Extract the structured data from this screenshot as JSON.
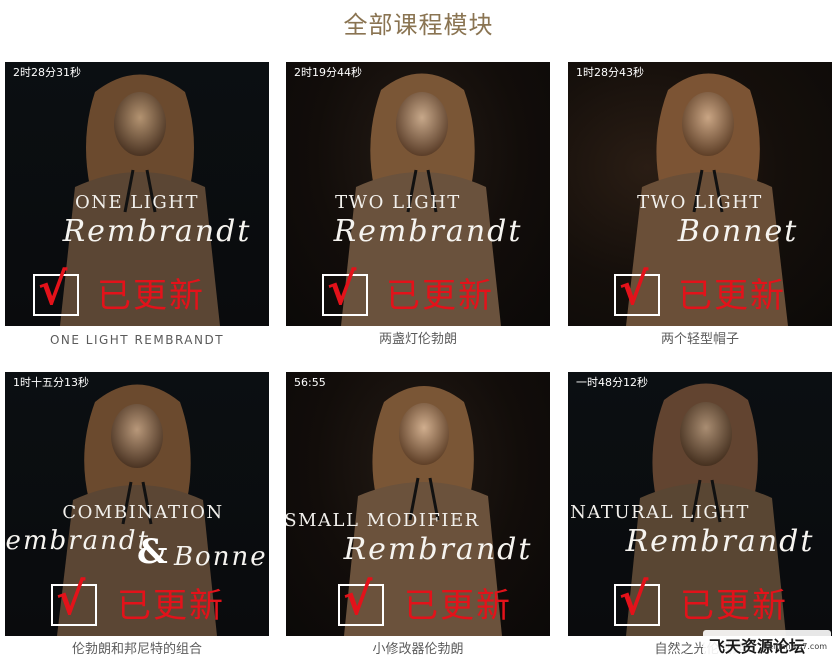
{
  "page_title": "全部课程模块",
  "updated_label": "已更新",
  "check_glyph": "√",
  "courses": [
    {
      "duration": "2时28分31秒",
      "thumb_top": "ONE LIGHT",
      "thumb_script": "Rembrandt",
      "caption": "ONE LIGHT REMBRANDT"
    },
    {
      "duration": "2时19分44秒",
      "thumb_top": "TWO LIGHT",
      "thumb_script": "Rembrandt",
      "caption": "两盏灯伦勃朗"
    },
    {
      "duration": "1时28分43秒",
      "thumb_top": "TWO LIGHT",
      "thumb_script": "Bonnet",
      "caption": "两个轻型帽子"
    },
    {
      "duration": "1时十五分13秒",
      "thumb_top": "COMBINATION",
      "thumb_script_left": "Rembrandt",
      "thumb_amp": "&",
      "thumb_script_right": "Bonnet",
      "caption": "伦勃朗和邦尼特的组合"
    },
    {
      "duration": "56:55",
      "thumb_top": "SMALL MODIFIER",
      "thumb_script": "Rembrandt",
      "caption": "小修改器伦勃朗"
    },
    {
      "duration": "一时48分12秒",
      "thumb_top": "NATURAL LIGHT",
      "thumb_script": "Rembrandt",
      "caption": "自然之光伦勃朗"
    }
  ],
  "watermark": {
    "logo_text": "飞天资源论坛",
    "url_text": "feitianwu7.com"
  }
}
